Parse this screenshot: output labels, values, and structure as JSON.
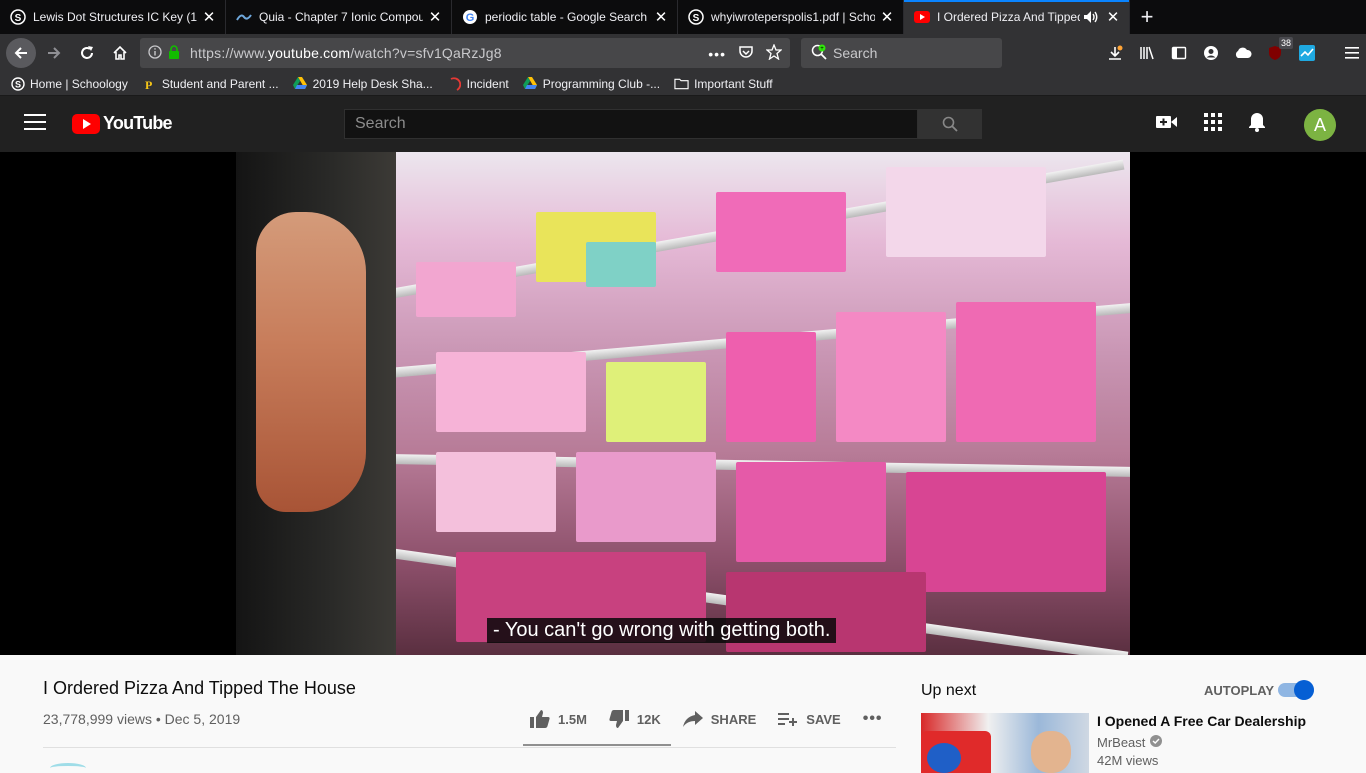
{
  "browser": {
    "tabs": [
      {
        "title": "Lewis Dot Structures IC Key (1)",
        "icon": "schoology-icon"
      },
      {
        "title": "Quia - Chapter 7 Ionic Compou",
        "icon": "quia-icon"
      },
      {
        "title": "periodic table - Google Search",
        "icon": "google-icon"
      },
      {
        "title": "whyiwroteperspolis1.pdf | Scho",
        "icon": "schoology-icon"
      },
      {
        "title": "I Ordered Pizza And Tipped",
        "icon": "youtube-icon",
        "active": true
      }
    ],
    "url_prefix": "https://www.",
    "url_domain": "youtube.com",
    "url_suffix": "/watch?v=sfv1QaRzJg8",
    "search_placeholder": "Search",
    "extension_badge": "38",
    "bookmarks": [
      {
        "label": "Home | Schoology",
        "icon": "schoology-icon"
      },
      {
        "label": "Student and Parent ...",
        "icon": "parent-portal-icon"
      },
      {
        "label": "2019 Help Desk Sha...",
        "icon": "google-drive-icon"
      },
      {
        "label": "Incident",
        "icon": "incident-icon"
      },
      {
        "label": "Programming Club -...",
        "icon": "google-drive-icon"
      },
      {
        "label": "Important Stuff",
        "icon": "folder-icon"
      }
    ]
  },
  "youtube": {
    "logo_text": "YouTube",
    "search_placeholder": "Search",
    "avatar_letter": "A",
    "caption": "- You can't go wrong with getting both.",
    "video": {
      "title": "I Ordered Pizza And Tipped The House",
      "meta": "23,778,999 views • Dec 5, 2019",
      "likes": "1.5M",
      "dislikes": "12K",
      "share_label": "SHARE",
      "save_label": "SAVE"
    },
    "sidebar": {
      "up_next_label": "Up next",
      "autoplay_label": "AUTOPLAY",
      "autoplay_on": true,
      "recommended": {
        "title": "I Opened A Free Car Dealership",
        "channel": "MrBeast",
        "views": "42M views"
      }
    }
  },
  "colors": {
    "accent": "#0a84ff",
    "youtube_red": "#ff0000",
    "toggle_blue": "#065fd4"
  }
}
